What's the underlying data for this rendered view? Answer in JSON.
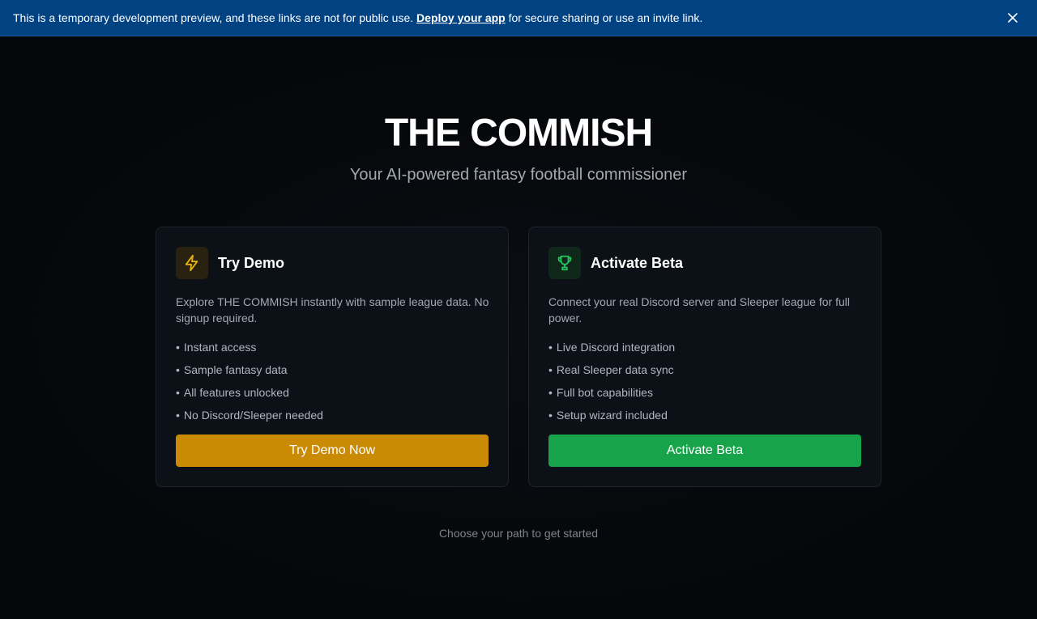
{
  "banner": {
    "text_before": "This is a temporary development preview, and these links are not for public use. ",
    "link_label": "Deploy your app",
    "text_after": " for secure sharing or use an invite link.",
    "background": "#004282"
  },
  "hero": {
    "title": "THE COMMISH",
    "subtitle": "Your AI-powered fantasy football commissioner"
  },
  "cards": [
    {
      "icon": "lightning-bolt-icon",
      "title": "Try Demo",
      "description": "Explore THE COMMISH instantly with sample league data. No signup required.",
      "features": [
        "Instant access",
        "Sample fantasy data",
        "All features unlocked",
        "No Discord/Sleeper needed"
      ],
      "button_label": "Try Demo Now",
      "accent": "#ca8a04"
    },
    {
      "icon": "trophy-icon",
      "title": "Activate Beta",
      "description": "Connect your real Discord server and Sleeper league for full power.",
      "features": [
        "Live Discord integration",
        "Real Sleeper data sync",
        "Full bot capabilities",
        "Setup wizard included"
      ],
      "button_label": "Activate Beta",
      "accent": "#16a34a"
    }
  ],
  "footer_note": "Choose your path to get started",
  "bullet": "•"
}
